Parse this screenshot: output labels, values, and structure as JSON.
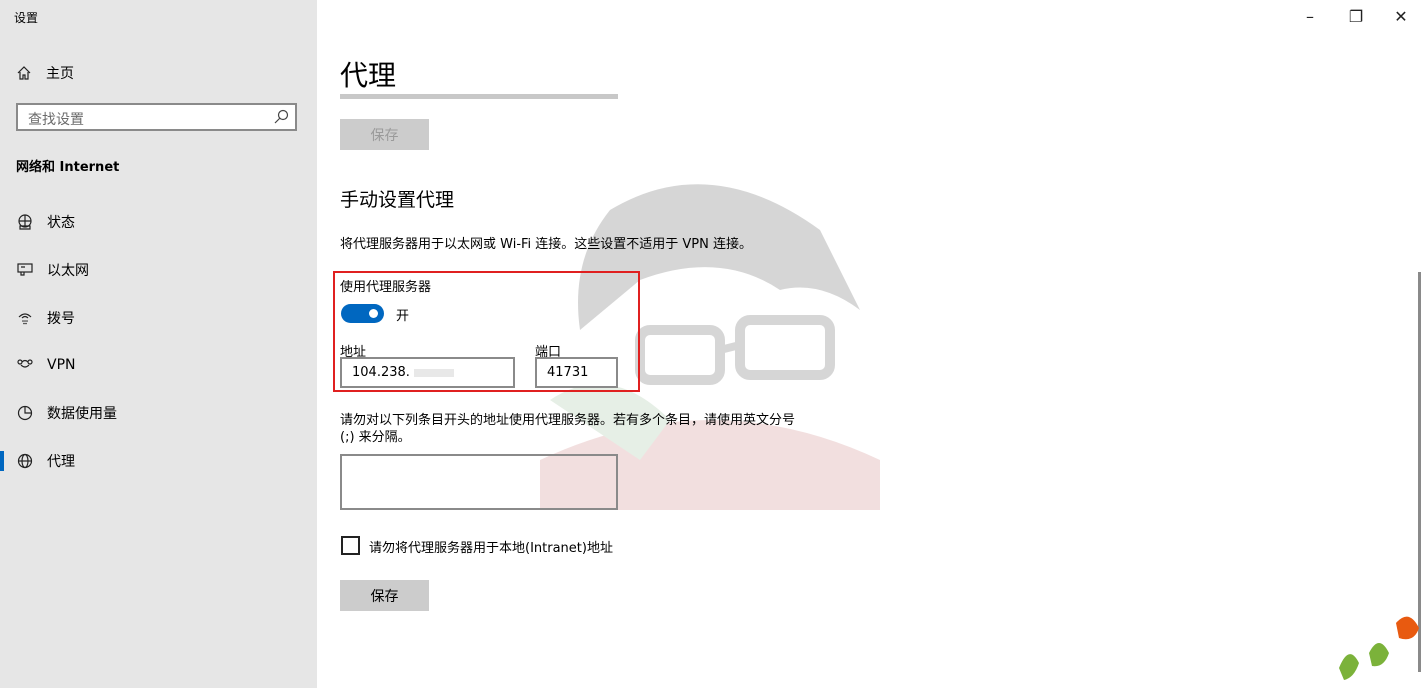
{
  "window": {
    "app_title": "设置",
    "minimize_glyph": "–",
    "restore_glyph": "❐",
    "close_glyph": "✕"
  },
  "sidebar": {
    "home_label": "主页",
    "search_placeholder": "查找设置",
    "section_title": "网络和 Internet",
    "items": [
      {
        "label": "状态",
        "icon": "status-globe-icon",
        "selected": false
      },
      {
        "label": "以太网",
        "icon": "ethernet-icon",
        "selected": false
      },
      {
        "label": "拨号",
        "icon": "dialup-icon",
        "selected": false
      },
      {
        "label": "VPN",
        "icon": "vpn-icon",
        "selected": false
      },
      {
        "label": "数据使用量",
        "icon": "data-usage-icon",
        "selected": false
      },
      {
        "label": "代理",
        "icon": "globe-icon",
        "selected": true
      }
    ]
  },
  "main": {
    "page_title": "代理",
    "top_save_label": "保存",
    "manual_heading": "手动设置代理",
    "manual_description": "将代理服务器用于以太网或 Wi-Fi 连接。这些设置不适用于 VPN 连接。",
    "use_proxy_label": "使用代理服务器",
    "toggle_state": "开",
    "toggle_on": true,
    "address_label": "地址",
    "address_value": "104.238.",
    "port_label": "端口",
    "port_value": "41731",
    "exceptions_text": "请勿对以下列条目开头的地址使用代理服务器。若有多个条目，请使用英文分号 (;) 来分隔。",
    "exceptions_value": "",
    "bypass_local_label": "请勿将代理服务器用于本地(Intranet)地址",
    "bypass_local_checked": false,
    "bottom_save_label": "保存"
  },
  "colors": {
    "accent": "#0067c0",
    "highlight_border": "#e02020",
    "sidebar_bg": "#e6e6e6"
  }
}
